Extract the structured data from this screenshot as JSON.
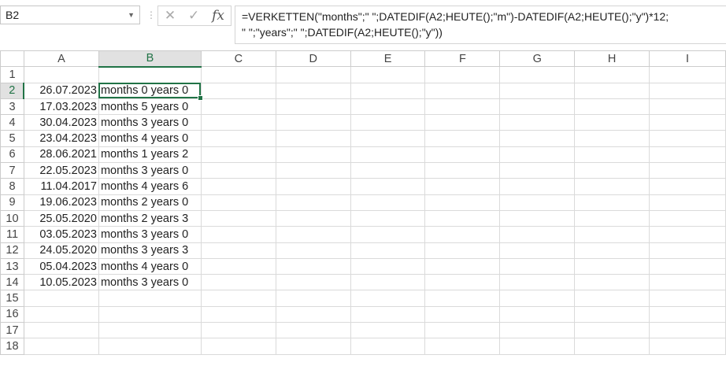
{
  "name_box": "B2",
  "formula_bar": {
    "line1": "=VERKETTEN(\"months\";\" \";DATEDIF(A2;HEUTE();\"m\")-DATEDIF(A2;HEUTE();\"y\")*12;",
    "line2": "\" \";\"years\";\" \";DATEDIF(A2;HEUTE();\"y\"))",
    "fx": "fx",
    "cancel": "✕",
    "enter": "✓"
  },
  "columns": [
    "A",
    "B",
    "C",
    "D",
    "E",
    "F",
    "G",
    "H",
    "I"
  ],
  "rows": [
    {
      "n": "1",
      "a": "",
      "b": ""
    },
    {
      "n": "2",
      "a": "26.07.2023",
      "b": "months 0 years 0"
    },
    {
      "n": "3",
      "a": "17.03.2023",
      "b": "months 5 years 0"
    },
    {
      "n": "4",
      "a": "30.04.2023",
      "b": "months 3 years 0"
    },
    {
      "n": "5",
      "a": "23.04.2023",
      "b": "months 4 years 0"
    },
    {
      "n": "6",
      "a": "28.06.2021",
      "b": "months 1 years 2"
    },
    {
      "n": "7",
      "a": "22.05.2023",
      "b": "months 3 years 0"
    },
    {
      "n": "8",
      "a": "11.04.2017",
      "b": "months 4 years 6"
    },
    {
      "n": "9",
      "a": "19.06.2023",
      "b": "months 2 years 0"
    },
    {
      "n": "10",
      "a": "25.05.2020",
      "b": "months 2 years 3"
    },
    {
      "n": "11",
      "a": "03.05.2023",
      "b": "months 3 years 0"
    },
    {
      "n": "12",
      "a": "24.05.2020",
      "b": "months 3 years 3"
    },
    {
      "n": "13",
      "a": "05.04.2023",
      "b": "months 4 years 0"
    },
    {
      "n": "14",
      "a": "10.05.2023",
      "b": "months 3 years 0"
    },
    {
      "n": "15",
      "a": "",
      "b": ""
    },
    {
      "n": "16",
      "a": "",
      "b": ""
    },
    {
      "n": "17",
      "a": "",
      "b": ""
    },
    {
      "n": "18",
      "a": "",
      "b": ""
    }
  ]
}
